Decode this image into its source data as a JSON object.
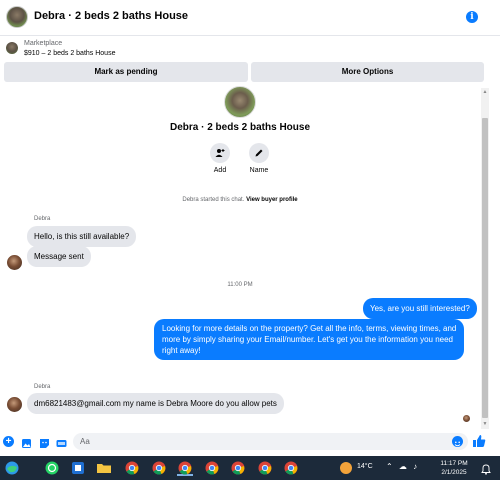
{
  "header": {
    "title": "Debra · 2 beds 2 baths House",
    "info_glyph": "i"
  },
  "marketplace": {
    "label": "Marketplace",
    "listing": "$910 – 2 beds 2 baths House"
  },
  "buttons": {
    "pending": "Mark as pending",
    "more": "More Options"
  },
  "conversation": {
    "title": "Debra · 2 beds 2 baths House",
    "actions": [
      {
        "label": "Add",
        "icon": "add-user-icon"
      },
      {
        "label": "Name",
        "icon": "pencil-icon"
      }
    ],
    "started_prefix": "Debra started this chat.",
    "started_link": "View buyer profile"
  },
  "messages": {
    "sender1": "Debra",
    "m1": "Hello, is this still available?",
    "m2": "Message sent",
    "time": "11:00 PM",
    "out1": "Yes, are you still interested?",
    "out2_lines": [
      "Looking for more details on the property? Get all the info, terms, viewing times, and",
      "more by simply sharing your Email/number. Let's get you the information you need",
      "right away!"
    ],
    "sender2": "Debra",
    "m3": "dm6821483@gmail.com my name is Debra Moore do you allow pets"
  },
  "composer": {
    "placeholder": "Aa",
    "plus_glyph": "+"
  },
  "taskbar": {
    "temperature": "14°C",
    "tray_glyphs": "⌃ ☁ ♪",
    "time": "11:17 PM",
    "date": "2/1/2025"
  },
  "colors": {
    "accent": "#0a7cff",
    "bubble_in": "#e4e6eb",
    "taskbar": "#1c2a3a"
  }
}
